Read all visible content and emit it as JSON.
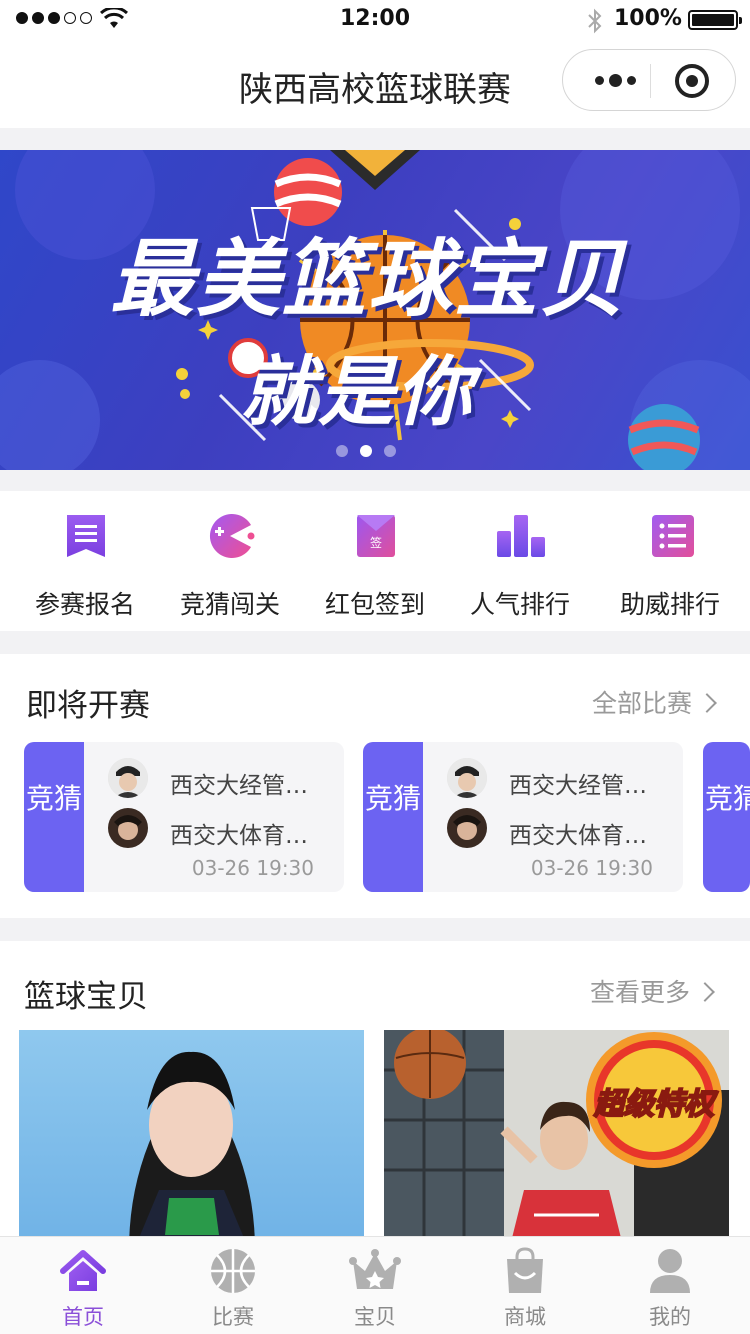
{
  "status_bar": {
    "time": "12:00",
    "battery_text": "100%",
    "signal_icon": "signal-dots-icon",
    "wifi_icon": "wifi-icon",
    "bluetooth_icon": "bluetooth-icon"
  },
  "nav": {
    "title": "陕西高校篮球联赛",
    "more_icon": "more-dots-icon",
    "close_icon": "target-circle-icon"
  },
  "banner": {
    "title_line1": "最美篮球宝贝",
    "title_line2": "就是你",
    "slide_count": 3,
    "active_slide": 2,
    "colors": {
      "bg_start": "#2f47c9",
      "bg_end": "#3850cf"
    }
  },
  "quick_menu": [
    {
      "label": "参赛报名",
      "icon": "registration-doc-icon"
    },
    {
      "label": "竞猜闯关",
      "icon": "pacman-icon"
    },
    {
      "label": "红包签到",
      "icon": "red-envelope-sign-icon",
      "icon_text": "签"
    },
    {
      "label": "人气排行",
      "icon": "bar-chart-icon"
    },
    {
      "label": "助威排行",
      "icon": "star-list-icon"
    }
  ],
  "upcoming": {
    "title": "即将开赛",
    "more_label": "全部比赛",
    "matches": [
      {
        "tag": "竞猜",
        "team_a": "西交大经管…",
        "team_b": "西交大体育…",
        "time": "03-26 19:30"
      },
      {
        "tag": "竞猜",
        "team_a": "西交大经管…",
        "team_b": "西交大体育…",
        "time": "03-26 19:30"
      },
      {
        "tag": "竞猜",
        "team_a": "",
        "team_b": "",
        "time": ""
      }
    ]
  },
  "babes": {
    "title": "篮球宝贝",
    "more_label": "查看更多",
    "badge_text": "超级特权"
  },
  "tabbar": [
    {
      "label": "首页",
      "icon": "home-icon",
      "active": true
    },
    {
      "label": "比赛",
      "icon": "basketball-icon",
      "active": false
    },
    {
      "label": "宝贝",
      "icon": "crown-icon",
      "active": false
    },
    {
      "label": "商城",
      "icon": "shopping-bag-icon",
      "active": false
    },
    {
      "label": "我的",
      "icon": "user-icon",
      "active": false
    }
  ],
  "colors": {
    "accent": "#8a4fd8",
    "match_tag": "#6c63f2"
  }
}
